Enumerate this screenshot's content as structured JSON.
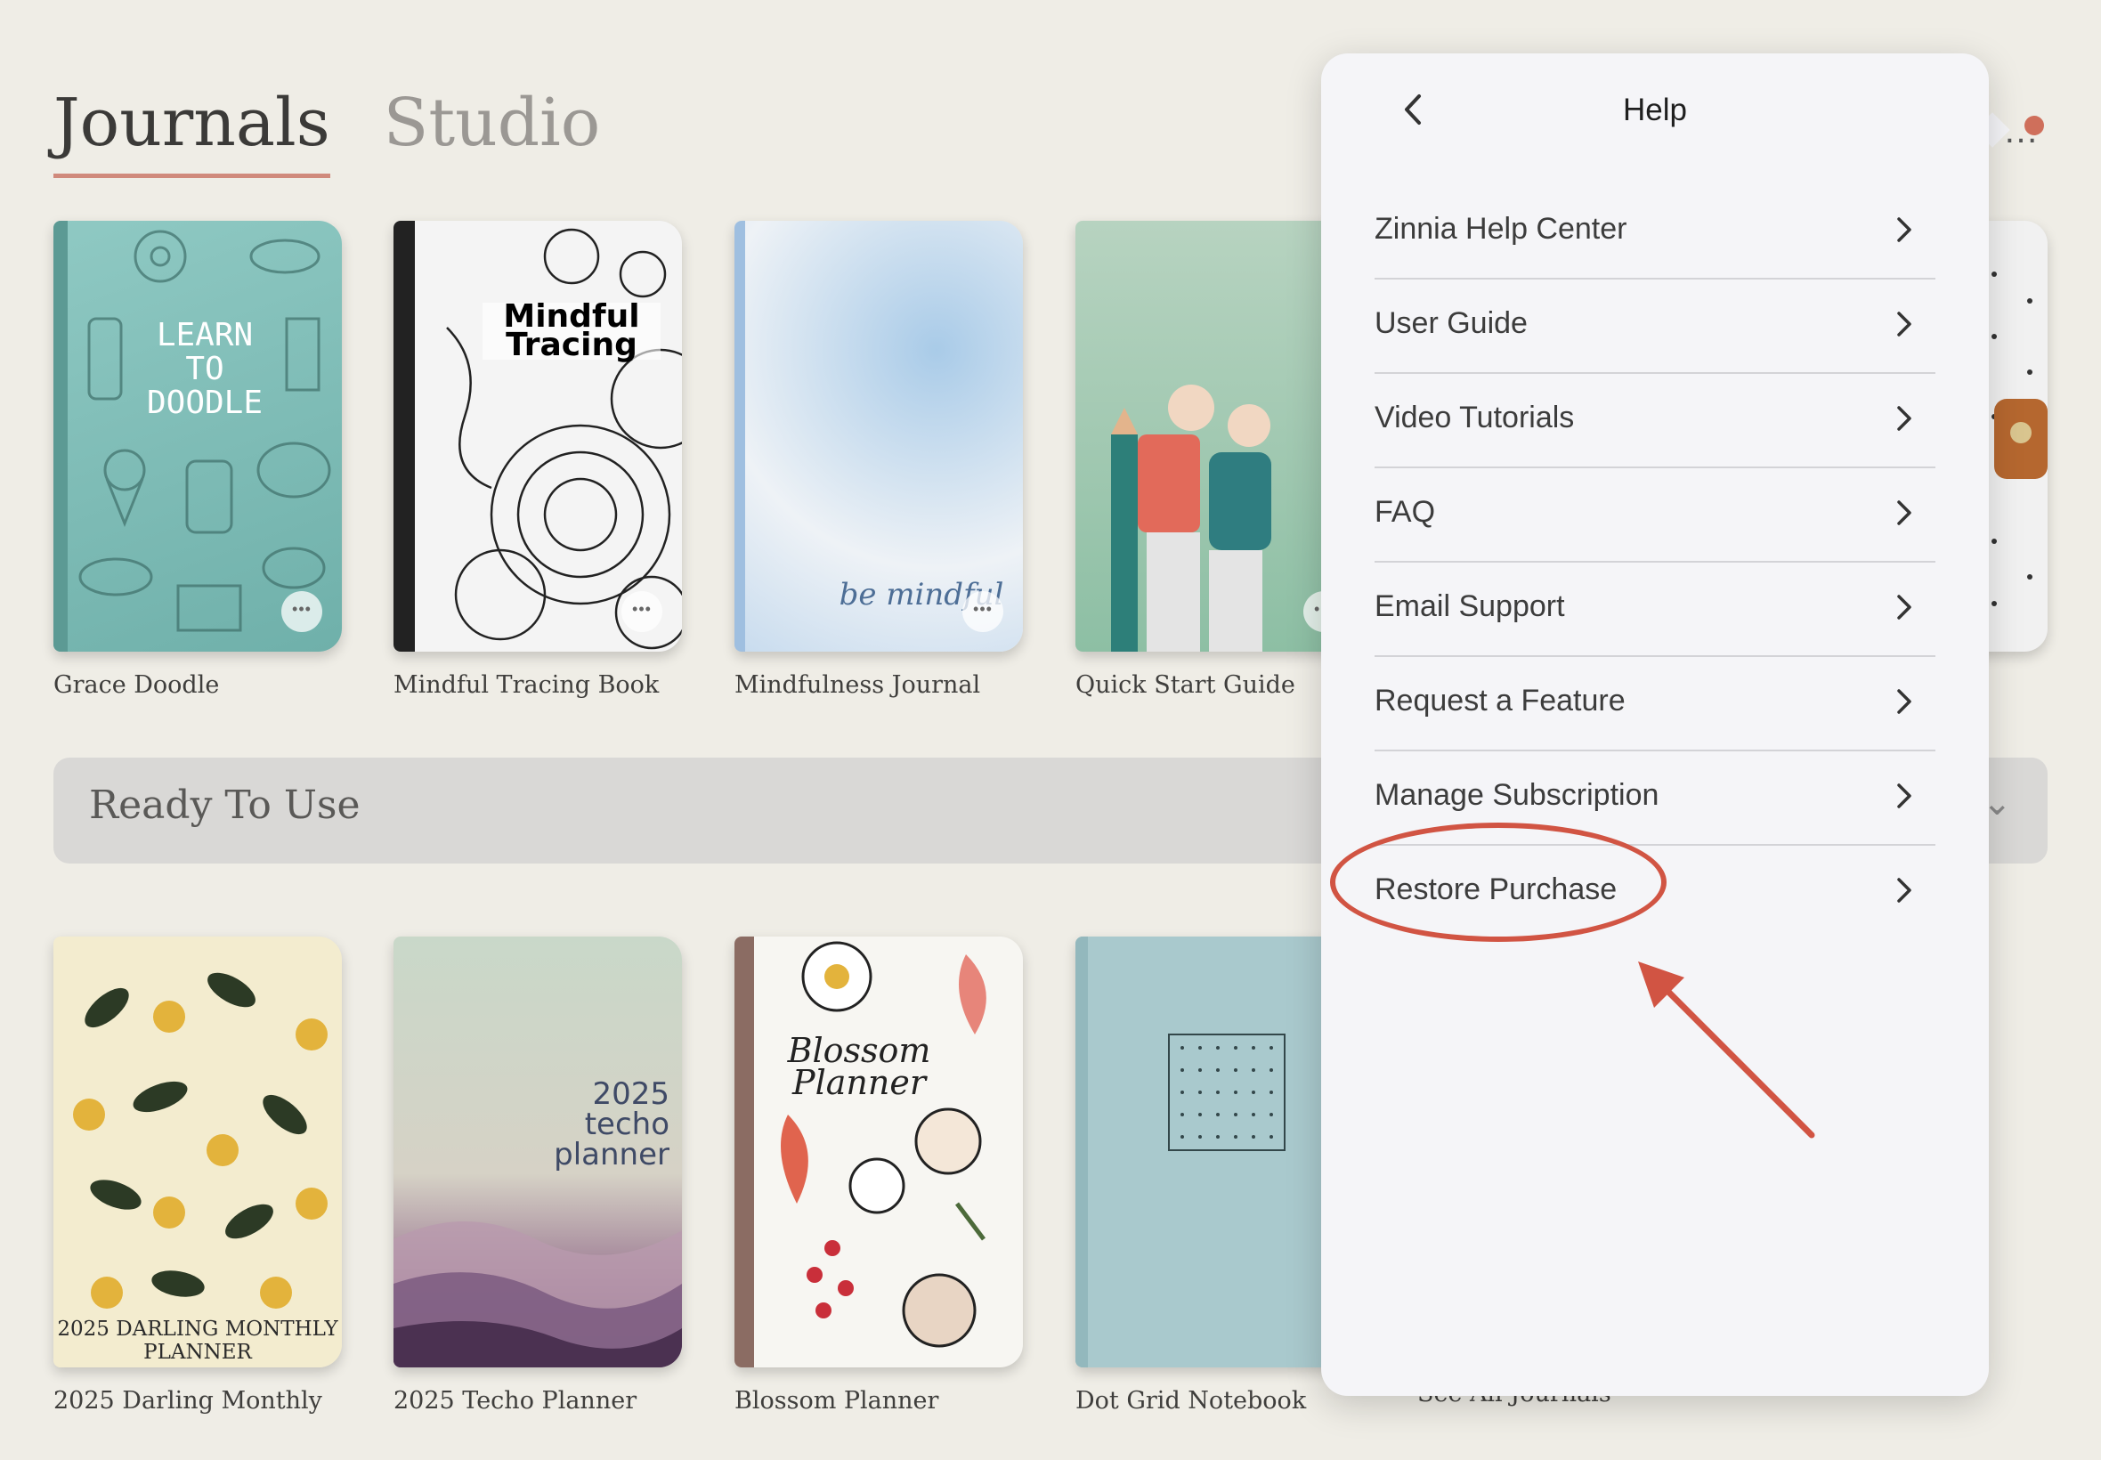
{
  "header": {
    "tabs": [
      {
        "label": "Journals",
        "active": true
      },
      {
        "label": "Studio",
        "active": false
      }
    ],
    "more_icon": "ellipsis-icon"
  },
  "journals": [
    {
      "title": "Grace Doodle",
      "cover_text": "LEARN TO DOODLE"
    },
    {
      "title": "Mindful Tracing Book",
      "cover_text": "Mindful Tracing"
    },
    {
      "title": "Mindfulness Journal",
      "cover_text": "be mindful"
    },
    {
      "title": "Quick Start Guide"
    }
  ],
  "ready_section": {
    "label": "Ready To Use"
  },
  "planners": [
    {
      "title": "2025 Darling Monthly",
      "cover_text": "2025 DARLING MONTHLY PLANNER"
    },
    {
      "title": "2025 Techo Planner",
      "cover_text": "2025 techo planner"
    },
    {
      "title": "Blossom Planner",
      "cover_text": "Blossom Planner"
    },
    {
      "title": "Dot Grid Notebook"
    }
  ],
  "see_all": "See All Journals",
  "help_panel": {
    "title": "Help",
    "items": [
      {
        "label": "Zinnia Help Center"
      },
      {
        "label": "User Guide"
      },
      {
        "label": "Video Tutorials"
      },
      {
        "label": "FAQ"
      },
      {
        "label": "Email Support"
      },
      {
        "label": "Request a Feature"
      },
      {
        "label": "Manage Subscription"
      },
      {
        "label": "Restore Purchase",
        "highlighted": true
      }
    ]
  },
  "colors": {
    "background": "#efede6",
    "accent_underline": "#d08a7c",
    "annotation_red": "#d15443",
    "panel_bg": "#f5f5f8"
  }
}
